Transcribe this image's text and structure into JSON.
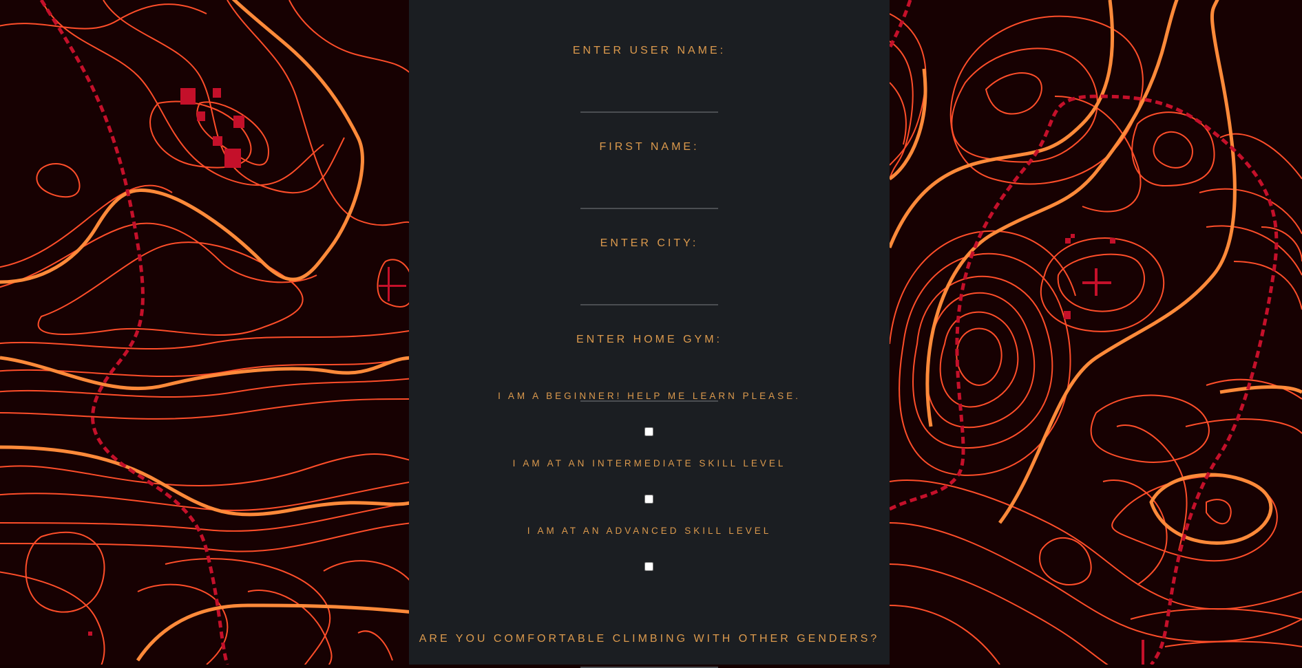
{
  "form": {
    "fields": [
      {
        "label": "ENTER USER NAME:",
        "value": ""
      },
      {
        "label": "FIRST NAME:",
        "value": ""
      },
      {
        "label": "ENTER CITY:",
        "value": ""
      },
      {
        "label": "ENTER HOME GYM:",
        "value": ""
      }
    ],
    "skill_levels": [
      {
        "label": "I AM A BEGINNER! HELP ME LEARN PLEASE.",
        "checked": false
      },
      {
        "label": "I AM AT AN INTERMEDIATE SKILL LEVEL",
        "checked": false
      },
      {
        "label": "I AM AT AN ADVANCED SKILL LEVEL",
        "checked": false
      }
    ],
    "gender_question": {
      "label": "ARE YOU COMFORTABLE CLIMBING WITH OTHER GENDERS?",
      "value": ""
    }
  },
  "colors": {
    "panel_bg": "#1b1e22",
    "label_text": "#dc9a4d",
    "map_bg": "#170102",
    "contour_main": "#ff4e2a",
    "contour_bold": "#ff8a3a",
    "trail": "#c4102a"
  }
}
